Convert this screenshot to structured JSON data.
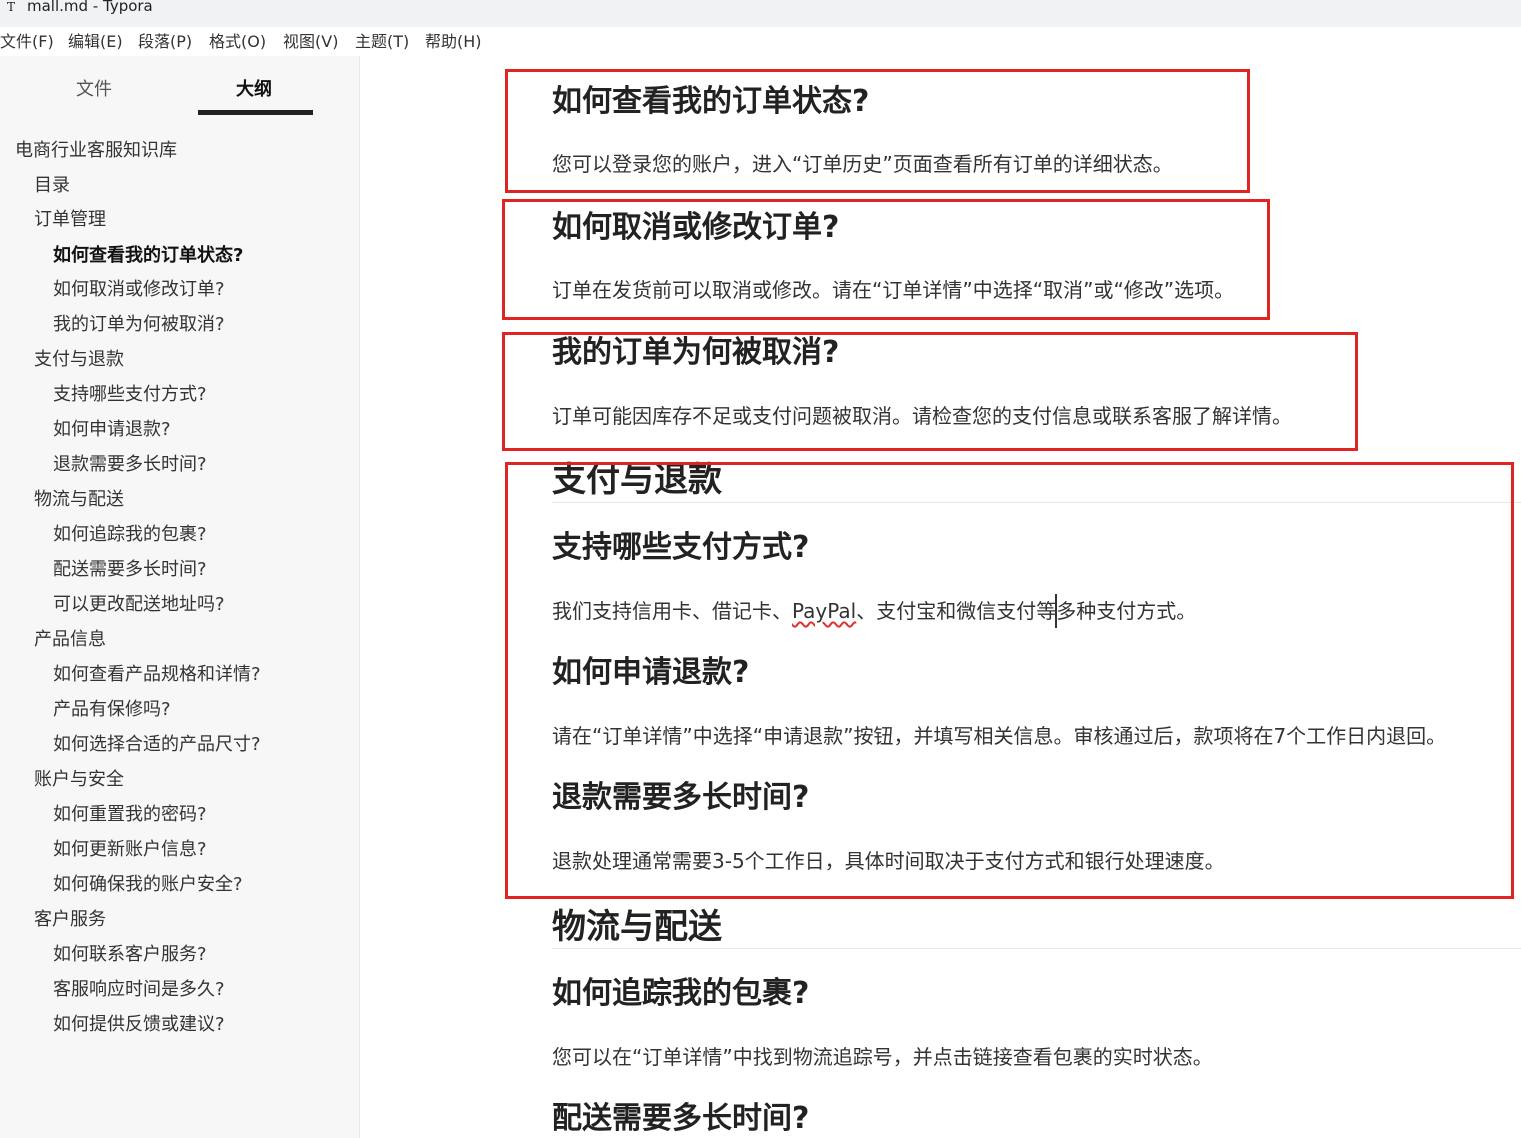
{
  "window": {
    "app_icon": "T",
    "title": "mall.md - Typora"
  },
  "menu": {
    "items": [
      "文件(F)",
      "编辑(E)",
      "段落(P)",
      "格式(O)",
      "视图(V)",
      "主题(T)",
      "帮助(H)"
    ]
  },
  "sidebar": {
    "tab_files": "文件",
    "tab_outline": "大纲",
    "active_tab": "大纲",
    "outline": [
      {
        "label": "电商行业客服知识库",
        "level": 1
      },
      {
        "label": "目录",
        "level": 2
      },
      {
        "label": "订单管理",
        "level": 2
      },
      {
        "label": "如何查看我的订单状态?",
        "level": 3,
        "active": true
      },
      {
        "label": "如何取消或修改订单?",
        "level": 3
      },
      {
        "label": "我的订单为何被取消?",
        "level": 3
      },
      {
        "label": "支付与退款",
        "level": 2
      },
      {
        "label": "支持哪些支付方式?",
        "level": 3
      },
      {
        "label": "如何申请退款?",
        "level": 3
      },
      {
        "label": "退款需要多长时间?",
        "level": 3
      },
      {
        "label": "物流与配送",
        "level": 2
      },
      {
        "label": "如何追踪我的包裹?",
        "level": 3
      },
      {
        "label": "配送需要多长时间?",
        "level": 3
      },
      {
        "label": "可以更改配送地址吗?",
        "level": 3
      },
      {
        "label": "产品信息",
        "level": 2
      },
      {
        "label": "如何查看产品规格和详情?",
        "level": 3
      },
      {
        "label": "产品有保修吗?",
        "level": 3
      },
      {
        "label": "如何选择合适的产品尺寸?",
        "level": 3
      },
      {
        "label": "账户与安全",
        "level": 2
      },
      {
        "label": "如何重置我的密码?",
        "level": 3
      },
      {
        "label": "如何更新账户信息?",
        "level": 3
      },
      {
        "label": "如何确保我的账户安全?",
        "level": 3
      },
      {
        "label": "客户服务",
        "level": 2
      },
      {
        "label": "如何联系客户服务?",
        "level": 3
      },
      {
        "label": "客服响应时间是多久?",
        "level": 3
      },
      {
        "label": "如何提供反馈或建议?",
        "level": 3
      }
    ]
  },
  "content": {
    "q_order_status": "如何查看我的订单状态?",
    "a_order_status": "您可以登录您的账户，进入“订单历史”页面查看所有订单的详细状态。",
    "q_cancel_modify": "如何取消或修改订单?",
    "a_cancel_modify": "订单在发货前可以取消或修改。请在“订单详情”中选择“取消”或“修改”选项。",
    "q_why_cancelled": "我的订单为何被取消?",
    "a_why_cancelled": "订单可能因库存不足或支付问题被取消。请检查您的支付信息或联系客服了解详情。",
    "h_payment": "支付与退款",
    "q_payment_methods": "支持哪些支付方式?",
    "a_payment_methods_pre": "我们支持信用卡、借记卡、",
    "a_payment_methods_spell": "PayPal",
    "a_payment_methods_post": "、支付宝和微信支付等多种支付方式。",
    "q_refund": "如何申请退款?",
    "a_refund": "请在“订单详情”中选择“申请退款”按钮，并填写相关信息。审核通过后，款项将在7个工作日内退回。",
    "q_refund_time": "退款需要多长时间?",
    "a_refund_time": "退款处理通常需要3-5个工作日，具体时间取决于支付方式和银行处理速度。",
    "h_logistics": "物流与配送",
    "q_track": "如何追踪我的包裹?",
    "a_track": "您可以在“订单详情”中找到物流追踪号，并点击链接查看包裹的实时状态。",
    "q_delivery_time": "配送需要多长时间?"
  },
  "colors": {
    "highlight_box": "#e02424",
    "sidebar_bg": "#f7f7f7",
    "titlebar_bg": "#f1f2f4"
  }
}
